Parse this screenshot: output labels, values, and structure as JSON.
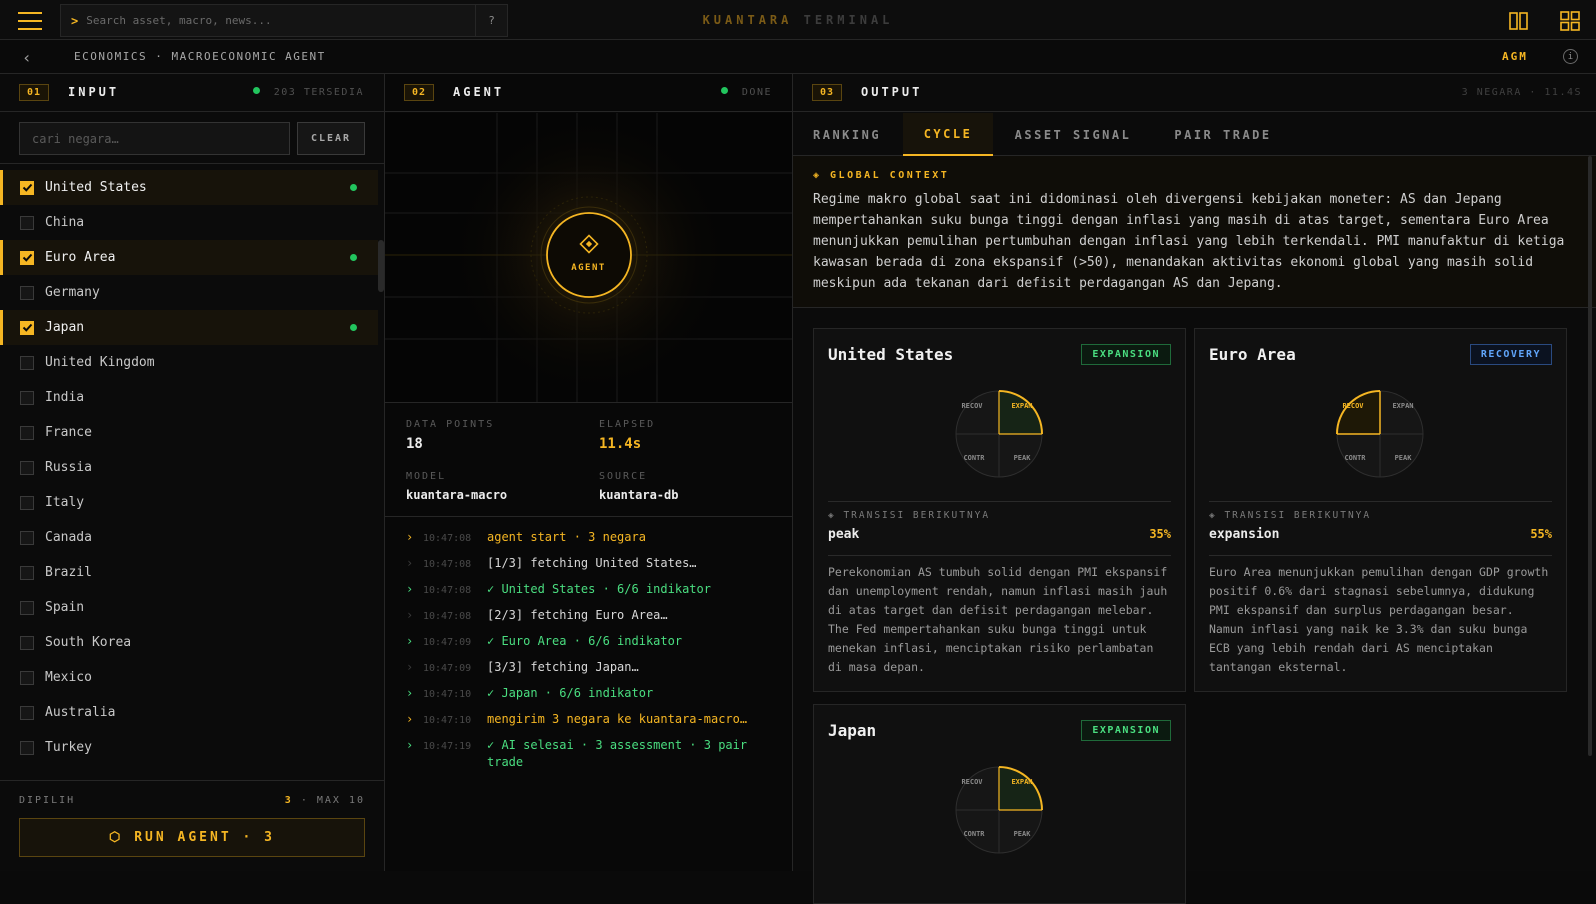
{
  "topbar": {
    "search_prompt": ">",
    "search_placeholder": "Search asset, macro, news...",
    "help_label": "?",
    "brand_primary": "KUANTARA",
    "brand_secondary": "TERMINAL",
    "accent_color": "#f5b623"
  },
  "subbar": {
    "back_label": "‹",
    "breadcrumb": "ECONOMICS · MACROECONOMIC AGENT",
    "mode": "AGM",
    "info_label": "i"
  },
  "input": {
    "num": "01",
    "title": "INPUT",
    "status": "203 TERSEDIA",
    "filter_placeholder": "cari negara…",
    "clear_label": "CLEAR",
    "countries": [
      {
        "name": "United States",
        "selected": true
      },
      {
        "name": "China",
        "selected": false
      },
      {
        "name": "Euro Area",
        "selected": true
      },
      {
        "name": "Germany",
        "selected": false
      },
      {
        "name": "Japan",
        "selected": true
      },
      {
        "name": "United Kingdom",
        "selected": false
      },
      {
        "name": "India",
        "selected": false
      },
      {
        "name": "France",
        "selected": false
      },
      {
        "name": "Russia",
        "selected": false
      },
      {
        "name": "Italy",
        "selected": false
      },
      {
        "name": "Canada",
        "selected": false
      },
      {
        "name": "Brazil",
        "selected": false
      },
      {
        "name": "Spain",
        "selected": false
      },
      {
        "name": "South Korea",
        "selected": false
      },
      {
        "name": "Mexico",
        "selected": false
      },
      {
        "name": "Australia",
        "selected": false
      },
      {
        "name": "Turkey",
        "selected": false
      }
    ],
    "footer_label": "DIPILIH",
    "selected_count": "3",
    "max_label": "· MAX 10",
    "run_label": "⬡ RUN AGENT · 3"
  },
  "agent": {
    "num": "02",
    "title": "AGENT",
    "status": "DONE",
    "core_label": "AGENT",
    "metrics": {
      "data_points_label": "DATA POINTS",
      "data_points": "18",
      "elapsed_label": "ELAPSED",
      "elapsed": "11.4s",
      "model_label": "MODEL",
      "model": "kuantara-macro",
      "source_label": "SOURCE",
      "source": "kuantara-db"
    },
    "log": [
      {
        "arrow": "›",
        "time": "10:47:08",
        "msg": "agent start · 3 negara",
        "tone": "gold"
      },
      {
        "arrow": "›",
        "time": "10:47:08",
        "msg": "[1/3] fetching United States…",
        "tone": "white"
      },
      {
        "arrow": "›",
        "time": "10:47:08",
        "msg": "✓ United States · 6/6 indikator",
        "tone": "green"
      },
      {
        "arrow": "›",
        "time": "10:47:08",
        "msg": "[2/3] fetching Euro Area…",
        "tone": "white"
      },
      {
        "arrow": "›",
        "time": "10:47:09",
        "msg": "✓ Euro Area · 6/6 indikator",
        "tone": "green"
      },
      {
        "arrow": "›",
        "time": "10:47:09",
        "msg": "[3/3] fetching Japan…",
        "tone": "white"
      },
      {
        "arrow": "›",
        "time": "10:47:10",
        "msg": "✓ Japan · 6/6 indikator",
        "tone": "green"
      },
      {
        "arrow": "›",
        "time": "10:47:10",
        "msg": "mengirim 3 negara ke kuantara-macro…",
        "tone": "gold"
      },
      {
        "arrow": "›",
        "time": "10:47:19",
        "msg": "✓ AI selesai · 3 assessment · 3 pair trade",
        "tone": "green"
      }
    ]
  },
  "output": {
    "num": "03",
    "title": "OUTPUT",
    "status": "3 NEGARA · 11.4S",
    "tabs": [
      "RANKING",
      "CYCLE",
      "ASSET SIGNAL",
      "PAIR TRADE"
    ],
    "active_tab": "CYCLE",
    "global_title": "◈ GLOBAL CONTEXT",
    "global_text": "Regime makro global saat ini didominasi oleh divergensi kebijakan moneter: AS dan Jepang mempertahankan suku bunga tinggi dengan inflasi yang masih di atas target, sementara Euro Area menunjukkan pemulihan pertumbuhan dengan inflasi yang lebih terkendali. PMI manufaktur di ketiga kawasan berada di zona ekspansif (>50), menandakan aktivitas ekonomi global yang masih solid meskipun ada tekanan dari defisit perdagangan AS dan Jepang.",
    "quadrants": {
      "recov": "RECOV",
      "expan": "EXPAN",
      "contr": "CONTR",
      "peak": "PEAK"
    },
    "next_label": "◈ TRANSISI BERIKUTNYA",
    "cards": [
      {
        "country": "United States",
        "phase": "EXPANSION",
        "active_quadrant": "expan",
        "next": "peak",
        "probability": "35%",
        "desc": "Perekonomian AS tumbuh solid dengan PMI ekspansif dan unemployment rendah, namun inflasi masih jauh di atas target dan defisit perdagangan melebar. The Fed mempertahankan suku bunga tinggi untuk menekan inflasi, menciptakan risiko perlambatan di masa depan."
      },
      {
        "country": "Euro Area",
        "phase": "RECOVERY",
        "active_quadrant": "recov",
        "next": "expansion",
        "probability": "55%",
        "desc": "Euro Area menunjukkan pemulihan dengan GDP growth positif 0.6% dari stagnasi sebelumnya, didukung PMI ekspansif dan surplus perdagangan besar. Namun inflasi yang naik ke 3.3% dan suku bunga ECB yang lebih rendah dari AS menciptakan tantangan eksternal."
      },
      {
        "country": "Japan",
        "phase": "EXPANSION",
        "active_quadrant": "expan"
      }
    ]
  }
}
